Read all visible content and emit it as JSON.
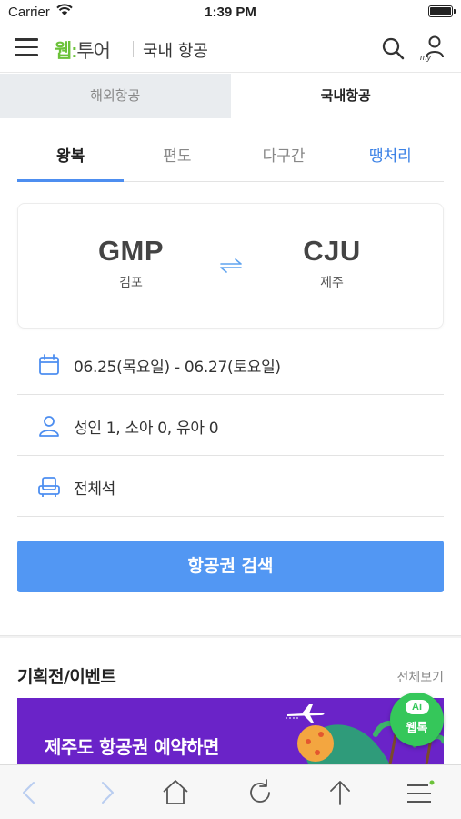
{
  "status_bar": {
    "carrier": "Carrier",
    "time": "1:39 PM"
  },
  "header": {
    "logo_main": "웹",
    "logo_dot": ":",
    "logo_rest": "투어",
    "title": "국내 항공",
    "menu_icon": "hamburger-menu-icon",
    "search_icon": "search-icon",
    "my_icon": "my-page-person-icon",
    "my_icon_text": "my"
  },
  "main_tabs": [
    {
      "label": "해외항공",
      "active": false
    },
    {
      "label": "국내항공",
      "active": true
    }
  ],
  "trip_tabs": [
    {
      "label": "왕복",
      "active": true
    },
    {
      "label": "편도",
      "active": false
    },
    {
      "label": "다구간",
      "active": false
    },
    {
      "label": "땡처리",
      "active": false
    }
  ],
  "route": {
    "from_code": "GMP",
    "from_city": "김포",
    "to_code": "CJU",
    "to_city": "제주",
    "swap_icon": "swap-arrows-icon"
  },
  "options": {
    "dates": "06.25(목요일)  - 06.27(토요일)",
    "passengers": "성인 1, 소아 0, 유아 0",
    "seat_class": "전체석"
  },
  "search_button": "항공권 검색",
  "events": {
    "title": "기획전/이벤트",
    "more": "전체보기",
    "banner_text": "제주도 항공권 예약하면",
    "banner_color": "#6a23c8"
  },
  "ai_chat": {
    "badge": "Ai",
    "label": "웹톡"
  },
  "colors": {
    "brand_green": "#6cc23a",
    "accent_blue": "#4d8ef0",
    "button_blue": "#5297f3",
    "special_blue": "#3c82e6",
    "chat_green": "#35c75a"
  },
  "bottom_nav": [
    "back-arrow-icon",
    "forward-arrow-icon",
    "home-icon",
    "refresh-icon",
    "share-up-arrow-icon",
    "menu-lines-icon"
  ]
}
